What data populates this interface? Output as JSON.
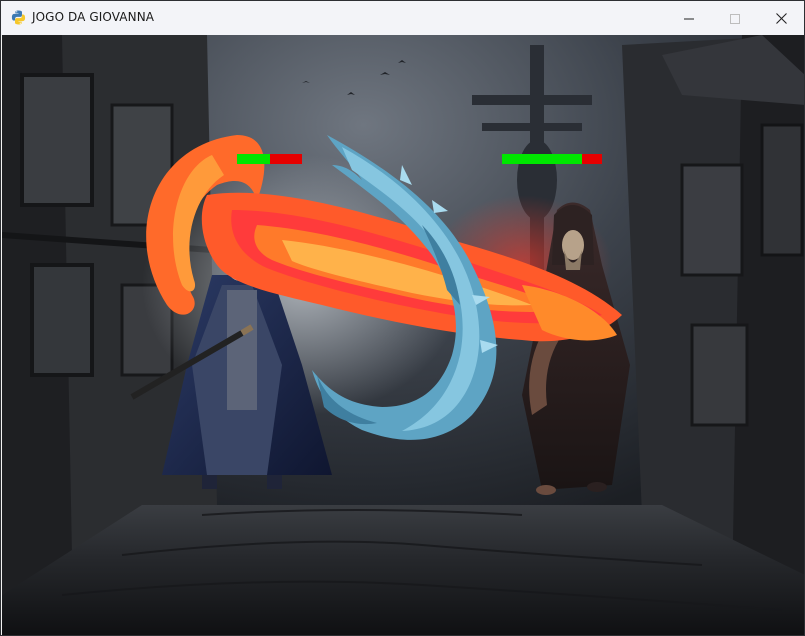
{
  "window": {
    "title": "JOGO DA GIOVANNA",
    "icon": "python-icon",
    "controls": [
      "minimize-icon",
      "maximize-icon",
      "close-icon"
    ]
  },
  "colors": {
    "health_fill": "#00e600",
    "health_empty": "#e60000",
    "fireball": "#ff5a2a",
    "water_wave": "#6fb7d8",
    "sky": "#3a3f48"
  },
  "hud": {
    "player_health": {
      "value": 0.5
    },
    "enemy_health": {
      "value": 0.8
    }
  },
  "scene": {
    "background": "dark-medieval-alley",
    "player": "armored-swordsman-sprite",
    "enemy": "hooded-wizard-sprite",
    "projectiles": [
      "fire-blast",
      "water-wave"
    ]
  }
}
